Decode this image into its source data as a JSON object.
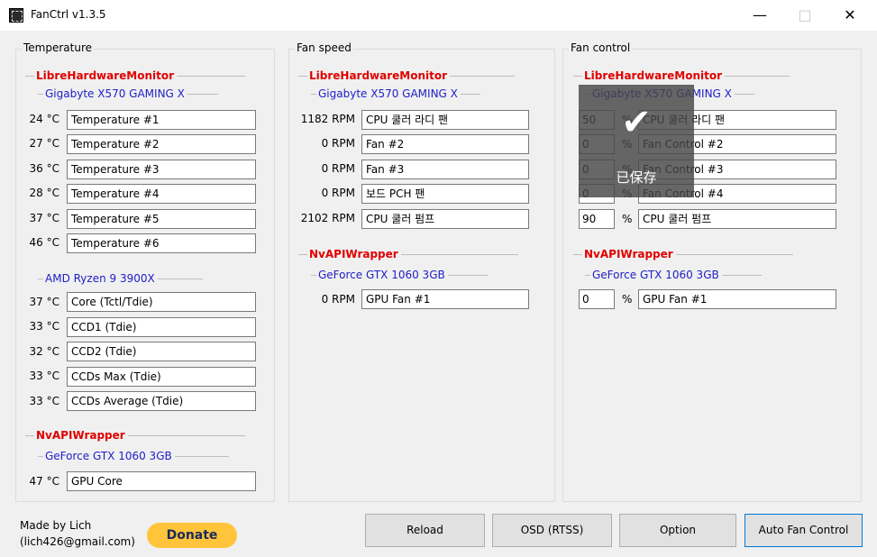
{
  "window": {
    "title": "FanCtrl v1.3.5",
    "minimize": "—",
    "maximize": "□",
    "close": "✕"
  },
  "temperature": {
    "legend": "Temperature",
    "groups": [
      {
        "provider": "LibreHardwareMonitor",
        "device": "Gigabyte X570 GAMING X",
        "rows": [
          {
            "value": "24 °C",
            "name": "Temperature #1"
          },
          {
            "value": "27 °C",
            "name": "Temperature #2"
          },
          {
            "value": "36 °C",
            "name": "Temperature #3"
          },
          {
            "value": "28 °C",
            "name": "Temperature #4"
          },
          {
            "value": "37 °C",
            "name": "Temperature #5"
          },
          {
            "value": "46 °C",
            "name": "Temperature #6"
          }
        ]
      },
      {
        "device": "AMD Ryzen 9 3900X",
        "rows": [
          {
            "value": "37 °C",
            "name": "Core (Tctl/Tdie)"
          },
          {
            "value": "33 °C",
            "name": "CCD1 (Tdie)"
          },
          {
            "value": "32 °C",
            "name": "CCD2 (Tdie)"
          },
          {
            "value": "33 °C",
            "name": "CCDs Max (Tdie)"
          },
          {
            "value": "33 °C",
            "name": "CCDs Average (Tdie)"
          }
        ]
      },
      {
        "provider": "NvAPIWrapper",
        "device": "GeForce GTX 1060 3GB",
        "rows": [
          {
            "value": "47 °C",
            "name": "GPU Core"
          }
        ]
      }
    ]
  },
  "fan_speed": {
    "legend": "Fan speed",
    "groups": [
      {
        "provider": "LibreHardwareMonitor",
        "device": "Gigabyte X570 GAMING X",
        "rows": [
          {
            "value": "1182 RPM",
            "name": "CPU 쿨러 라디 팬"
          },
          {
            "value": "0 RPM",
            "name": "Fan #2"
          },
          {
            "value": "0 RPM",
            "name": "Fan #3"
          },
          {
            "value": "0 RPM",
            "name": "보드 PCH 팬"
          },
          {
            "value": "2102 RPM",
            "name": "CPU 쿨러 펌프"
          }
        ]
      },
      {
        "provider": "NvAPIWrapper",
        "device": "GeForce GTX 1060 3GB",
        "rows": [
          {
            "value": "0 RPM",
            "name": "GPU Fan #1"
          }
        ]
      }
    ]
  },
  "fan_control": {
    "legend": "Fan control",
    "percent_symbol": "%",
    "groups": [
      {
        "provider": "LibreHardwareMonitor",
        "device": "Gigabyte X570 GAMING X",
        "rows": [
          {
            "value": "50",
            "name": "CPU 쿨러 라디 팬"
          },
          {
            "value": "0",
            "name": "Fan Control #2"
          },
          {
            "value": "0",
            "name": "Fan Control #3"
          },
          {
            "value": "0",
            "name": "Fan Control #4"
          },
          {
            "value": "90",
            "name": "CPU 쿨러 펌프"
          }
        ]
      },
      {
        "provider": "NvAPIWrapper",
        "device": "GeForce GTX 1060 3GB",
        "rows": [
          {
            "value": "0",
            "name": "GPU Fan #1"
          }
        ]
      }
    ]
  },
  "toast": {
    "icon": "checkmark-icon",
    "text": "已保存"
  },
  "footer": {
    "made_by_line1": "Made by Lich",
    "made_by_line2": "(lich426@gmail.com)",
    "donate": "Donate",
    "reload": "Reload",
    "osd": "OSD (RTSS)",
    "option": "Option",
    "auto_fan": "Auto Fan Control"
  },
  "colors": {
    "provider": "#e00000",
    "device": "#2020c8",
    "donate_bg": "#ffc439",
    "focus_border": "#0078d7"
  }
}
